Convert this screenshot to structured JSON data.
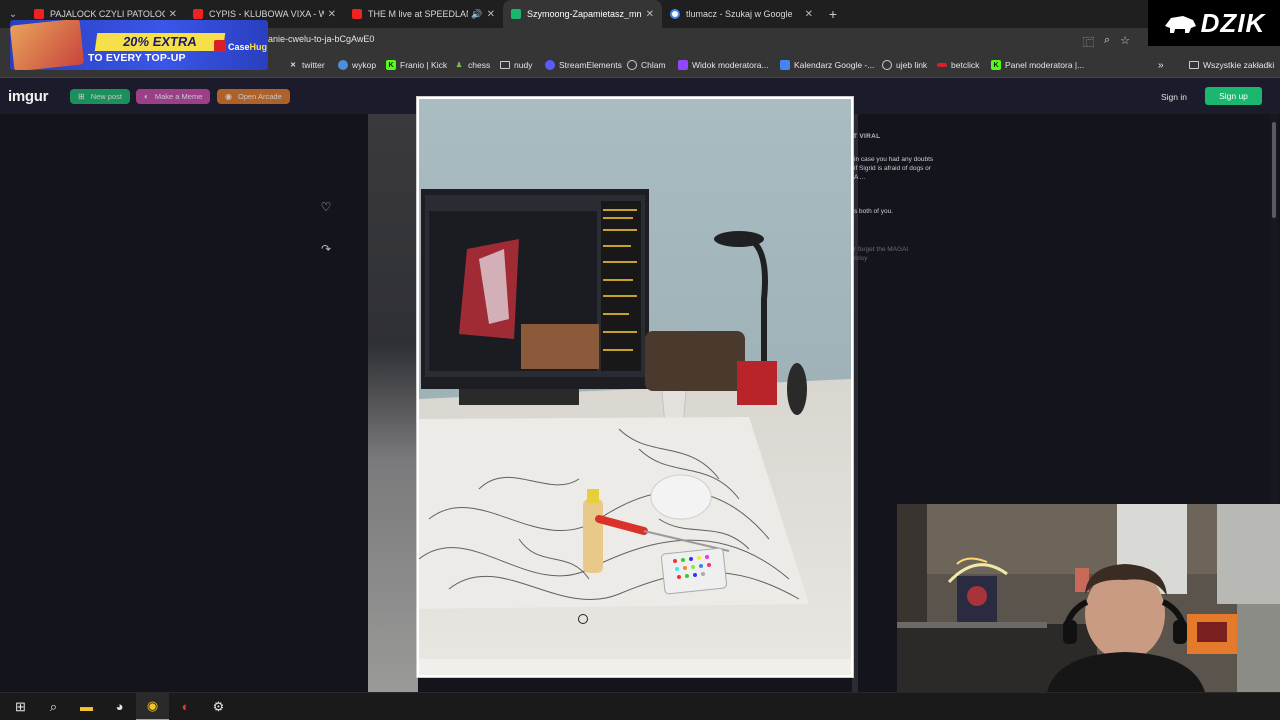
{
  "browser": {
    "tabs": [
      {
        "title": "PAJALOCK CZYLI PATOLOGIA N",
        "favicon_color": "#e22",
        "active": false,
        "audio": false
      },
      {
        "title": "CYPIS - KLUBOWA VIXA - WER",
        "favicon_color": "#e22",
        "active": false,
        "audio": false
      },
      {
        "title": "THE M live at SPEEDLAND",
        "favicon_color": "#e22",
        "active": false,
        "audio": true
      },
      {
        "title": "Szymoong-Zapamietasz_mnie_",
        "favicon_color": "#1bb76e",
        "active": true,
        "audio": false
      },
      {
        "title": "tlumacz - Szukaj w Google",
        "favicon_color": "#4285f4",
        "active": false,
        "audio": false
      }
    ],
    "url": "anie-cwelu-to-ja-bCgAwE0",
    "bookmarks": [
      {
        "label": "twitter",
        "icon": "x-icon",
        "color": "#e5e5e5"
      },
      {
        "label": "wykop",
        "icon": "wykop-icon",
        "color": "#4a90d9"
      },
      {
        "label": "Franio | Kick",
        "icon": "kick-icon",
        "color": "#53fc18"
      },
      {
        "label": "chess",
        "icon": "chess-icon",
        "color": "#81b64c"
      },
      {
        "label": "nudy",
        "icon": "folder-icon",
        "color": "#e5e5e5"
      },
      {
        "label": "StreamElements",
        "icon": "streamelements-icon",
        "color": "#5b5bff"
      },
      {
        "label": "Chlam",
        "icon": "globe-icon",
        "color": "#e5e5e5"
      },
      {
        "label": "Widok moderatora...",
        "icon": "twitch-icon",
        "color": "#9146ff"
      },
      {
        "label": "Kalendarz Google -...",
        "icon": "calendar-icon",
        "color": "#4285f4"
      },
      {
        "label": "ujeb link",
        "icon": "globe-icon",
        "color": "#e5e5e5"
      },
      {
        "label": "betclick",
        "icon": "betclic-icon",
        "color": "#d81f2a"
      },
      {
        "label": "Panel moderatora |...",
        "icon": "kick-icon",
        "color": "#53fc18"
      }
    ],
    "all_bookmarks": "Wszystkie zakładki"
  },
  "promo": {
    "line1": "20% EXTRA",
    "line2": "TO EVERY TOP-UP",
    "brand_a": "Case",
    "brand_b": "Hug"
  },
  "overlay_logo": "DZIK",
  "imgur": {
    "logo": "imgur",
    "new_post": "New post",
    "make_meme": "Make a Meme",
    "open_arcade": "Open Arcade",
    "sign_in": "Sign in",
    "sign_up": "Sign up",
    "viral_title": "T VIRAL",
    "comments": [
      "in case you had any doubts",
      "if Sigrid is afraid of dogs or",
      "A ...",
      "s both of you.",
      "r forget the MAGAt",
      "crisy"
    ]
  },
  "colors": {
    "signup_green": "#1bb76e",
    "newpost_green": "#1bb76e",
    "meme_pink": "#c94ba8",
    "arcade_orange": "#e07a2a"
  }
}
